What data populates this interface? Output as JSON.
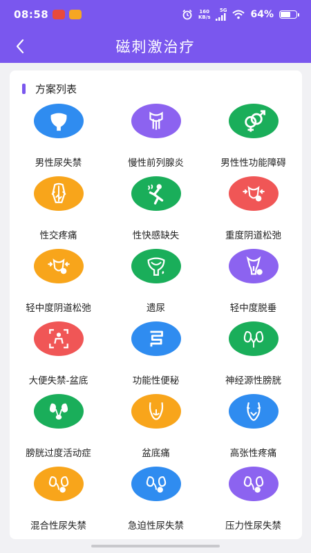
{
  "status": {
    "time": "08:58",
    "net_speed_top": "160",
    "net_speed_unit": "KB/s",
    "signal": "5G",
    "battery": "64%",
    "battery_level": 0.64
  },
  "header": {
    "title": "磁刺激治疗",
    "back_icon": "chevron-left-icon"
  },
  "section": {
    "title": "方案列表"
  },
  "colors": {
    "primary": "#7a57ee",
    "blue": "#2f8cf0",
    "purple": "#8c63f0",
    "green": "#1aae5a",
    "orange": "#f8a51b",
    "red": "#f05656"
  },
  "items": [
    {
      "label": "男性尿失禁",
      "color": "#2f8cf0",
      "icon": "bladder-icon"
    },
    {
      "label": "慢性前列腺炎",
      "color": "#8c63f0",
      "icon": "prostate-icon"
    },
    {
      "label": "男性性功能障碍",
      "color": "#1aae5a",
      "icon": "gender-symbols-icon"
    },
    {
      "label": "性交疼痛",
      "color": "#f8a51b",
      "icon": "back-pain-icon"
    },
    {
      "label": "性快感缺失",
      "color": "#1aae5a",
      "icon": "squat-figure-icon"
    },
    {
      "label": "重度阴道松弛",
      "color": "#f05656",
      "icon": "pelvis-arrows-icon"
    },
    {
      "label": "轻中度阴道松弛",
      "color": "#f8a51b",
      "icon": "pelvis-arrows-icon"
    },
    {
      "label": "遗尿",
      "color": "#1aae5a",
      "icon": "bladder-drop-icon"
    },
    {
      "label": "轻中度脱垂",
      "color": "#8c63f0",
      "icon": "uterus-icon"
    },
    {
      "label": "大便失禁-盆底",
      "color": "#f05656",
      "icon": "scan-body-icon"
    },
    {
      "label": "功能性便秘",
      "color": "#2f8cf0",
      "icon": "intestine-icon"
    },
    {
      "label": "神经源性膀胱",
      "color": "#1aae5a",
      "icon": "kidneys-icon"
    },
    {
      "label": "膀胱过度活动症",
      "color": "#1aae5a",
      "icon": "kidneys-bladder-icon"
    },
    {
      "label": "盆底痛",
      "color": "#f8a51b",
      "icon": "hips-icon"
    },
    {
      "label": "高张性疼痛",
      "color": "#2f8cf0",
      "icon": "abdomen-icon"
    },
    {
      "label": "混合性尿失禁",
      "color": "#f8a51b",
      "icon": "kidney-pill-icon"
    },
    {
      "label": "急迫性尿失禁",
      "color": "#2f8cf0",
      "icon": "kidney-pill-icon"
    },
    {
      "label": "压力性尿失禁",
      "color": "#8c63f0",
      "icon": "kidney-pill-icon"
    }
  ]
}
